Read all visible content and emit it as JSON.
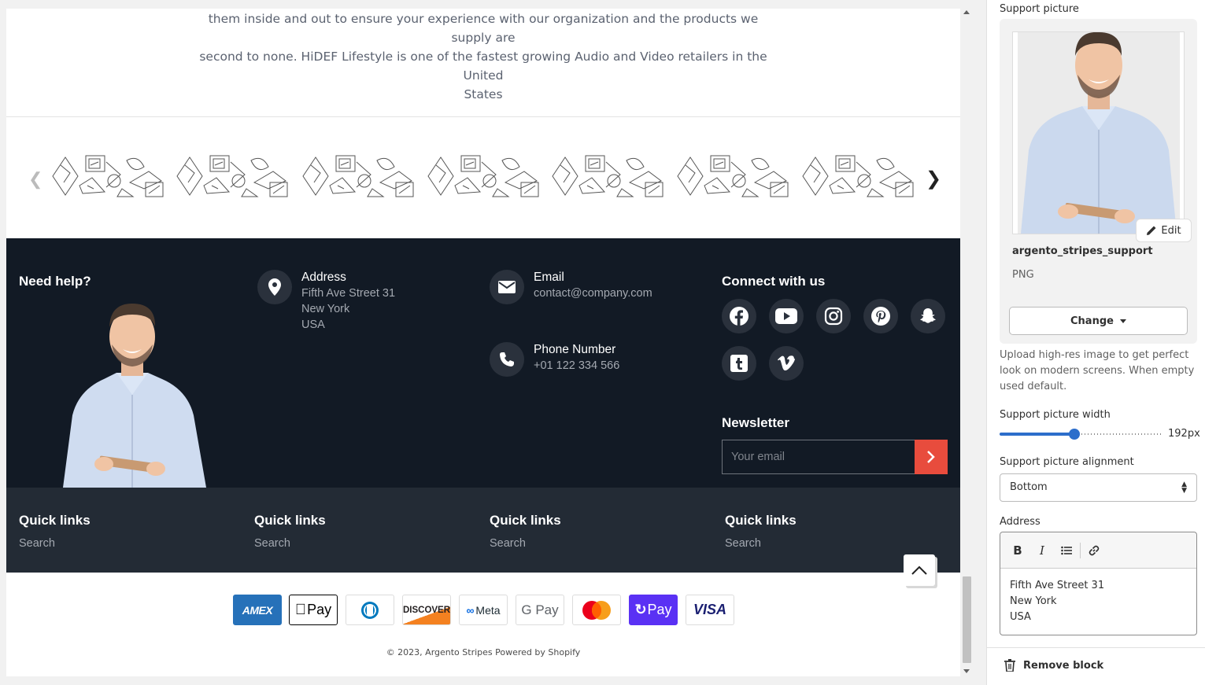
{
  "intro": {
    "line1": "them inside and out to ensure your experience with our organization and the products we supply are",
    "line2": "second to none. HiDEF Lifestyle is one of the fastest growing Audio and Video retailers in the United",
    "line3": "States"
  },
  "footer": {
    "need_help": "Need help?",
    "address": {
      "title": "Address",
      "line1": "Fifth Ave Street 31",
      "line2": "New York",
      "line3": "USA"
    },
    "email": {
      "title": "Email",
      "value": "contact@company.com"
    },
    "phone": {
      "title": "Phone Number",
      "value": "+01 122 334 566"
    },
    "connect_title": "Connect with us",
    "social_icons": [
      "facebook-icon",
      "youtube-icon",
      "instagram-icon",
      "pinterest-icon",
      "snapchat-icon",
      "tumblr-icon",
      "vimeo-icon"
    ],
    "newsletter": {
      "title": "Newsletter",
      "placeholder": "Your email"
    },
    "quick_links": [
      {
        "title": "Quick links",
        "link": "Search"
      },
      {
        "title": "Quick links",
        "link": "Search"
      },
      {
        "title": "Quick links",
        "link": "Search"
      },
      {
        "title": "Quick links",
        "link": "Search"
      }
    ],
    "payments": [
      "AMEX",
      "Pay",
      "Diners Club",
      "DISCOVER",
      "Meta",
      "G Pay",
      "Mastercard",
      "Pay",
      "VISA"
    ],
    "copyright": "© 2023, Argento Stripes Powered by Shopify"
  },
  "panel": {
    "support_picture_label": "Support picture",
    "edit_label": "Edit",
    "file_name": "argento_stripes_support",
    "file_type": "PNG",
    "change_label": "Change",
    "help_text": "Upload high-res image to get perfect look on modern screens. When empty used default.",
    "width_label": "Support picture width",
    "width_value": "192px",
    "width_fraction": 0.46,
    "alignment_label": "Support picture alignment",
    "alignment_value": "Bottom",
    "address_label": "Address",
    "address_lines": [
      "Fifth Ave Street 31",
      "New York",
      "USA"
    ],
    "remove_label": "Remove block"
  },
  "colors": {
    "footer_dark": "#121a25",
    "footer_mid": "#232b35",
    "accent": "#e84c3d",
    "slider": "#2c6ecb"
  }
}
